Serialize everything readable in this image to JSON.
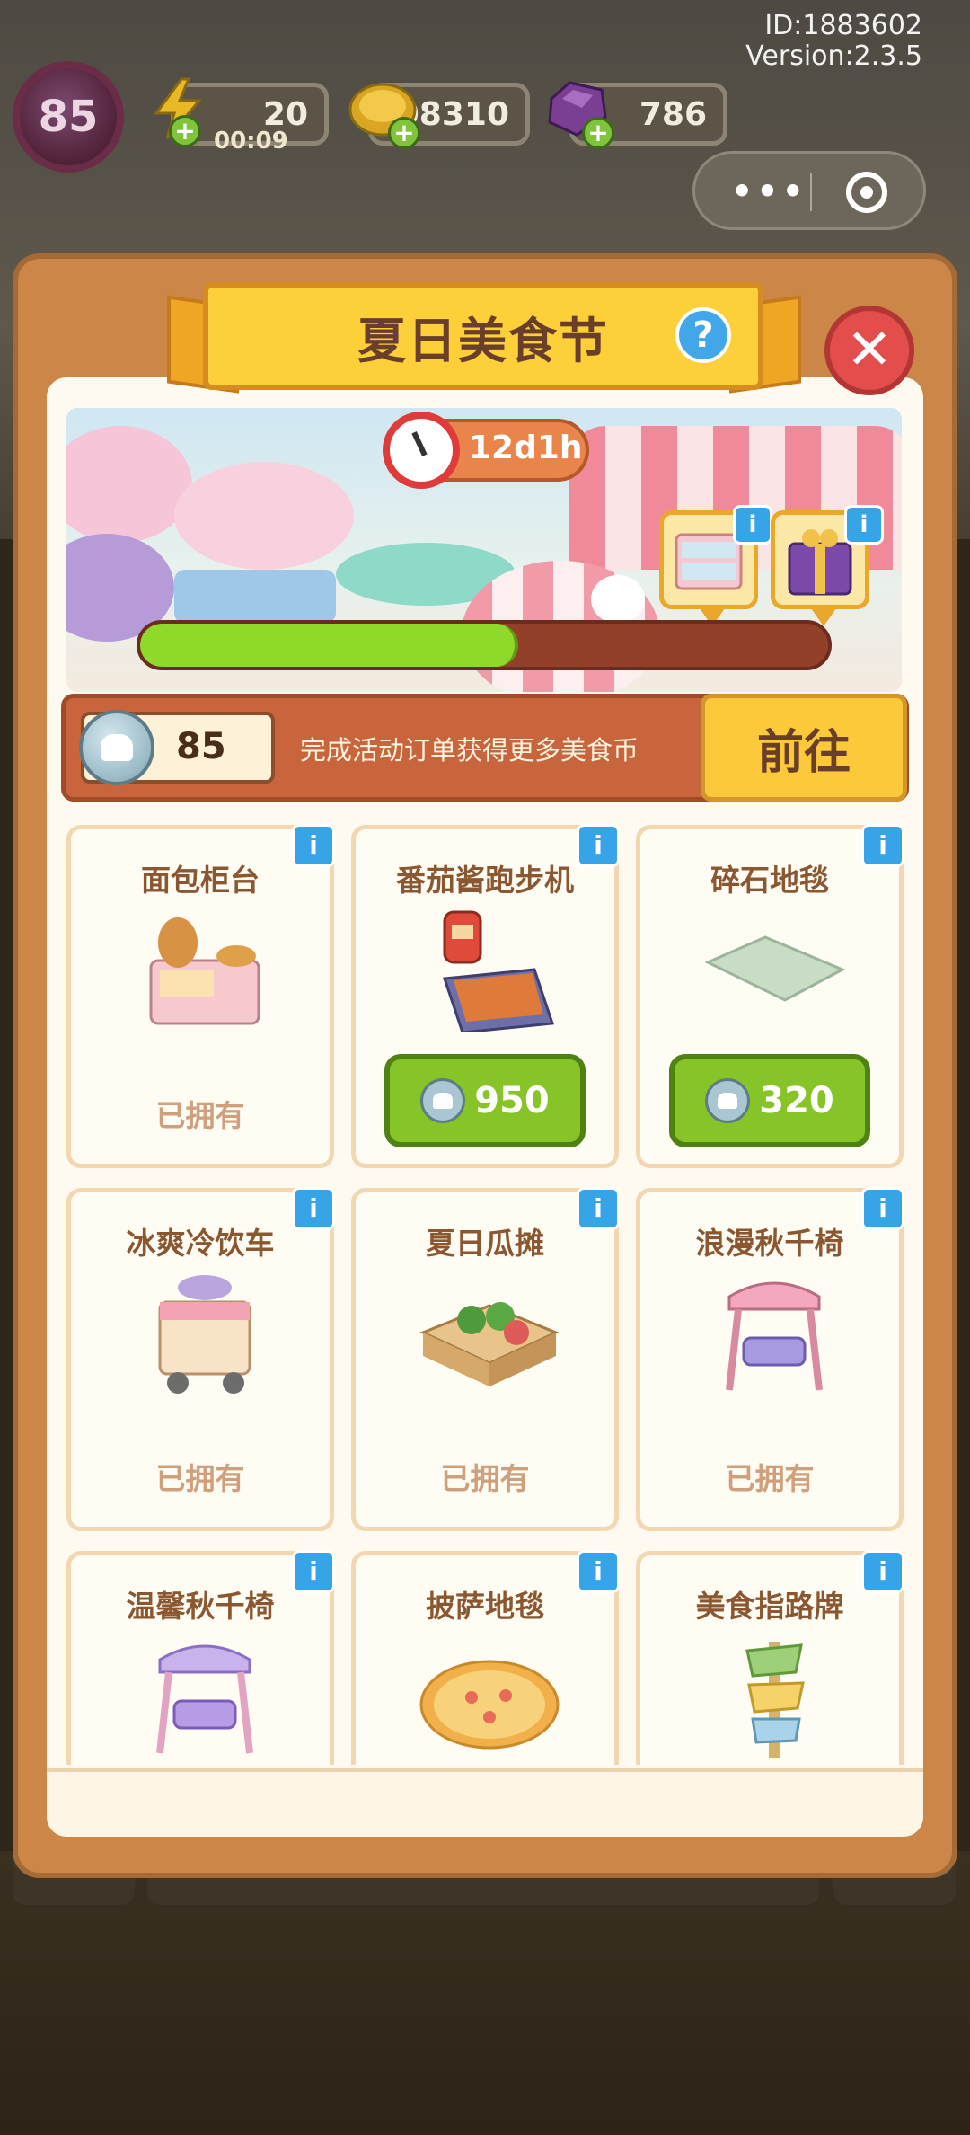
{
  "meta": {
    "id_text": "ID:1883602",
    "version_text": "Version:2.3.5"
  },
  "hud": {
    "level": "85",
    "energy": "20",
    "energy_timer": "00:09",
    "gold": "108310",
    "gems": "786"
  },
  "event": {
    "title": "夏日美食节",
    "help": "?",
    "close": "✕",
    "time_left": "12d1h",
    "progress_fraction": 0.55
  },
  "currency": {
    "amount": "85",
    "description": "完成活动订单获得更多美食币",
    "go_label": "前往"
  },
  "info_glyph": "i",
  "items": [
    {
      "name": "面包柜台",
      "status": "已拥有",
      "icon": "bread-counter-icon"
    },
    {
      "name": "番茄酱跑步机",
      "price": "950",
      "icon": "ketchup-treadmill-icon"
    },
    {
      "name": "碎石地毯",
      "price": "320",
      "icon": "gravel-rug-icon"
    },
    {
      "name": "冰爽冷饮车",
      "status": "已拥有",
      "icon": "drink-cart-icon"
    },
    {
      "name": "夏日瓜摊",
      "status": "已拥有",
      "icon": "melon-stall-icon"
    },
    {
      "name": "浪漫秋千椅",
      "status": "已拥有",
      "icon": "pink-swing-icon"
    },
    {
      "name": "温馨秋千椅",
      "icon": "purple-swing-icon"
    },
    {
      "name": "披萨地毯",
      "icon": "pizza-rug-icon"
    },
    {
      "name": "美食指路牌",
      "icon": "food-signpost-icon"
    }
  ]
}
